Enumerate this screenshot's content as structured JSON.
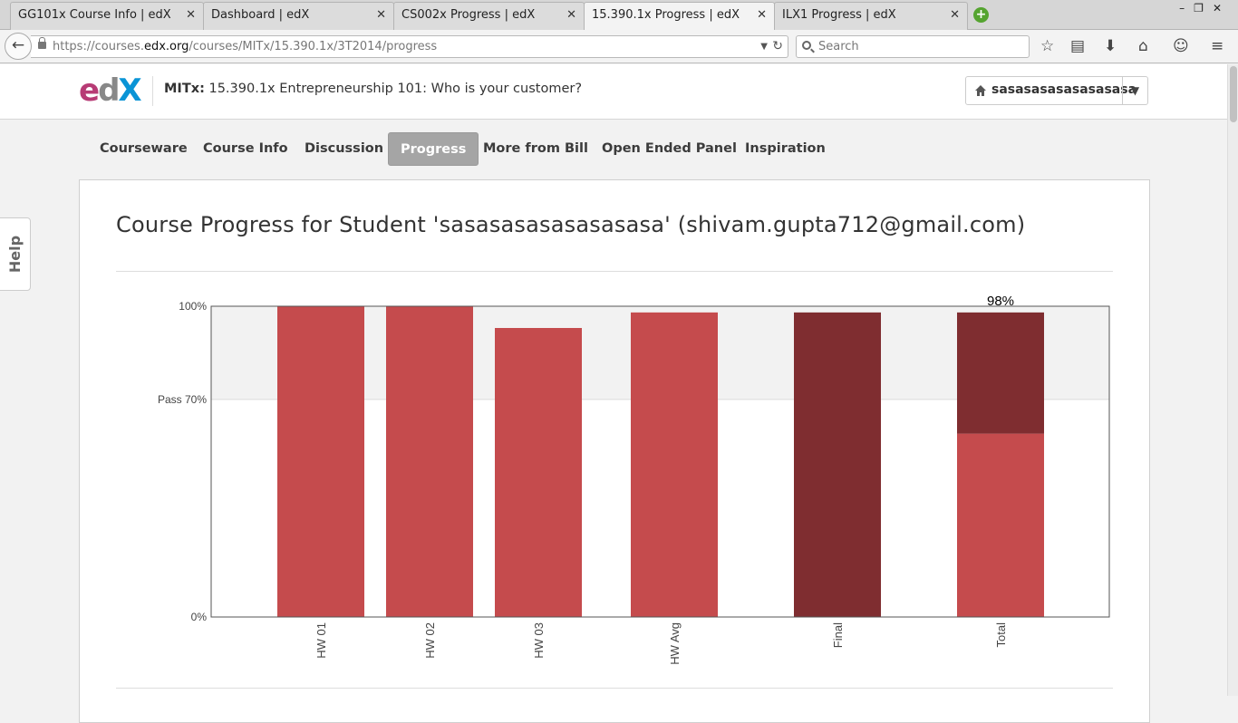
{
  "browser": {
    "tabs": [
      {
        "title": "GG101x Course Info | edX",
        "active": false
      },
      {
        "title": "Dashboard | edX",
        "active": false
      },
      {
        "title": "CS002x Progress | edX",
        "active": false
      },
      {
        "title": "15.390.1x Progress | edX",
        "active": true
      },
      {
        "title": "ILX1 Progress | edX",
        "active": false
      }
    ],
    "url_prefix": "https://courses.",
    "url_host": "edx.org",
    "url_path": "/courses/MITx/15.390.1x/3T2014/progress",
    "search_placeholder": "Search"
  },
  "header": {
    "logo": {
      "e": "e",
      "d": "d",
      "x": "X"
    },
    "org": "MITx:",
    "course": "15.390.1x Entrepreneurship 101: Who is your customer?",
    "username": "sasasasasasasasasa"
  },
  "course_nav": {
    "tabs": [
      {
        "label": "Courseware",
        "active": false
      },
      {
        "label": "Course Info",
        "active": false
      },
      {
        "label": "Discussion",
        "active": false
      },
      {
        "label": "Progress",
        "active": true
      },
      {
        "label": "More from Bill",
        "active": false
      },
      {
        "label": "Open Ended Panel",
        "active": false
      },
      {
        "label": "Inspiration",
        "active": false
      }
    ]
  },
  "help_label": "Help",
  "page_title": "Course Progress for Student 'sasasasasasasasasa' (shivam.gupta712@gmail.com)",
  "chart_data": {
    "type": "bar",
    "categories": [
      "HW 01",
      "HW 02",
      "HW 03",
      "HW Avg",
      "Final",
      "Total"
    ],
    "values": [
      100,
      100,
      93,
      98,
      98,
      98
    ],
    "total_breakdown": {
      "homework_part": 59,
      "final_part": 39
    },
    "y_ticks": [
      {
        "value": 100,
        "label": "100%"
      },
      {
        "value": 70,
        "label": "Pass 70%"
      },
      {
        "value": 0,
        "label": "0%"
      }
    ],
    "ylim": [
      0,
      100
    ],
    "pass_threshold": 70,
    "total_label": "98%",
    "colors": {
      "homework": "#c54b4d",
      "final": "#7f2d30",
      "pass_zone": "#f2f2f2"
    }
  }
}
